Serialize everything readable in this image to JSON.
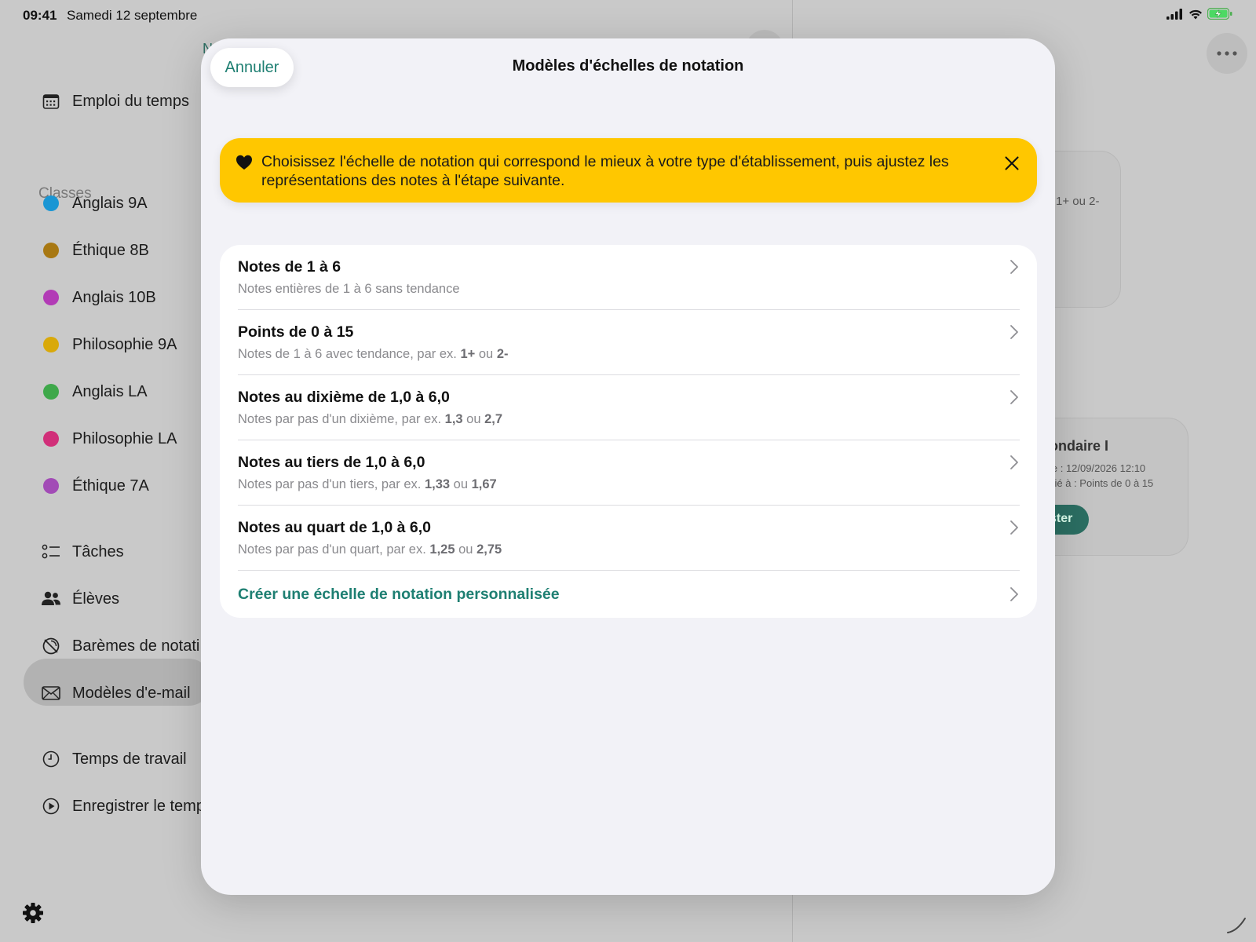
{
  "status_bar": {
    "time": "09:41",
    "date": "Samedi 12 septembre"
  },
  "sidebar": {
    "top_item": "Emploi du temps",
    "section_label": "Classes",
    "classes": [
      {
        "label": "Anglais 9A",
        "color": "#1a96d4"
      },
      {
        "label": "Éthique 8B",
        "color": "#a87812"
      },
      {
        "label": "Anglais 10B",
        "color": "#b23bb6"
      },
      {
        "label": "Philosophie 9A",
        "color": "#d9a90a"
      },
      {
        "label": "Anglais LA",
        "color": "#3ea84a"
      },
      {
        "label": "Philosophie LA",
        "color": "#d12f79"
      },
      {
        "label": "Éthique 7A",
        "color": "#a24bb6"
      }
    ],
    "nav": [
      {
        "label": "Tâches",
        "icon": "checklist-icon"
      },
      {
        "label": "Élèves",
        "icon": "people-icon"
      },
      {
        "label": "Barèmes de notati",
        "icon": "grading-scale-icon"
      },
      {
        "label": "Modèles d'e-mail",
        "icon": "envelope-icon"
      },
      {
        "label": "Temps de travail",
        "icon": "clock-icon"
      },
      {
        "label": "Enregistrer le temp",
        "icon": "play-circle-icon"
      }
    ],
    "active_index": 2
  },
  "background": {
    "card1_text": "1+ ou 2-",
    "card2_title": "ondaire I",
    "card2_line1": "le : 12/09/2026 12:10",
    "card2_line2": "cié à : Points de 0 à 15",
    "card2_button": "ster",
    "stub_letter": "N"
  },
  "modal": {
    "cancel_label": "Annuler",
    "title": "Modèles d'échelles de notation",
    "banner": {
      "icon": "heart-icon",
      "message": "Choisissez l'échelle de notation qui correspond le mieux à votre type d'établissement, puis ajustez les représentations des notes à l'étape suivante.",
      "color": "#ffc700"
    },
    "accent_color": "#1e7f72",
    "options": [
      {
        "title": "Notes de 1 à 6",
        "subtitle_prefix": "Notes entières de 1 à 6 sans tendance",
        "ex1": "",
        "conj": "",
        "ex2": ""
      },
      {
        "title": "Points de 0 à 15",
        "subtitle_prefix": "Notes de 1 à 6 avec tendance, par ex.",
        "ex1": "1+",
        "conj": "ou",
        "ex2": "2-"
      },
      {
        "title": "Notes au dixième de 1,0 à 6,0",
        "subtitle_prefix": "Notes par pas d'un dixième, par ex.",
        "ex1": "1,3",
        "conj": "ou",
        "ex2": "2,7"
      },
      {
        "title": "Notes au tiers de 1,0 à 6,0",
        "subtitle_prefix": "Notes par pas d'un tiers, par ex.",
        "ex1": "1,33",
        "conj": "ou",
        "ex2": "1,67"
      },
      {
        "title": "Notes au quart de 1,0 à 6,0",
        "subtitle_prefix": "Notes par pas d'un quart, par ex.",
        "ex1": "1,25",
        "conj": "ou",
        "ex2": "2,75"
      }
    ],
    "custom_option": "Créer une échelle de notation personnalisée"
  }
}
